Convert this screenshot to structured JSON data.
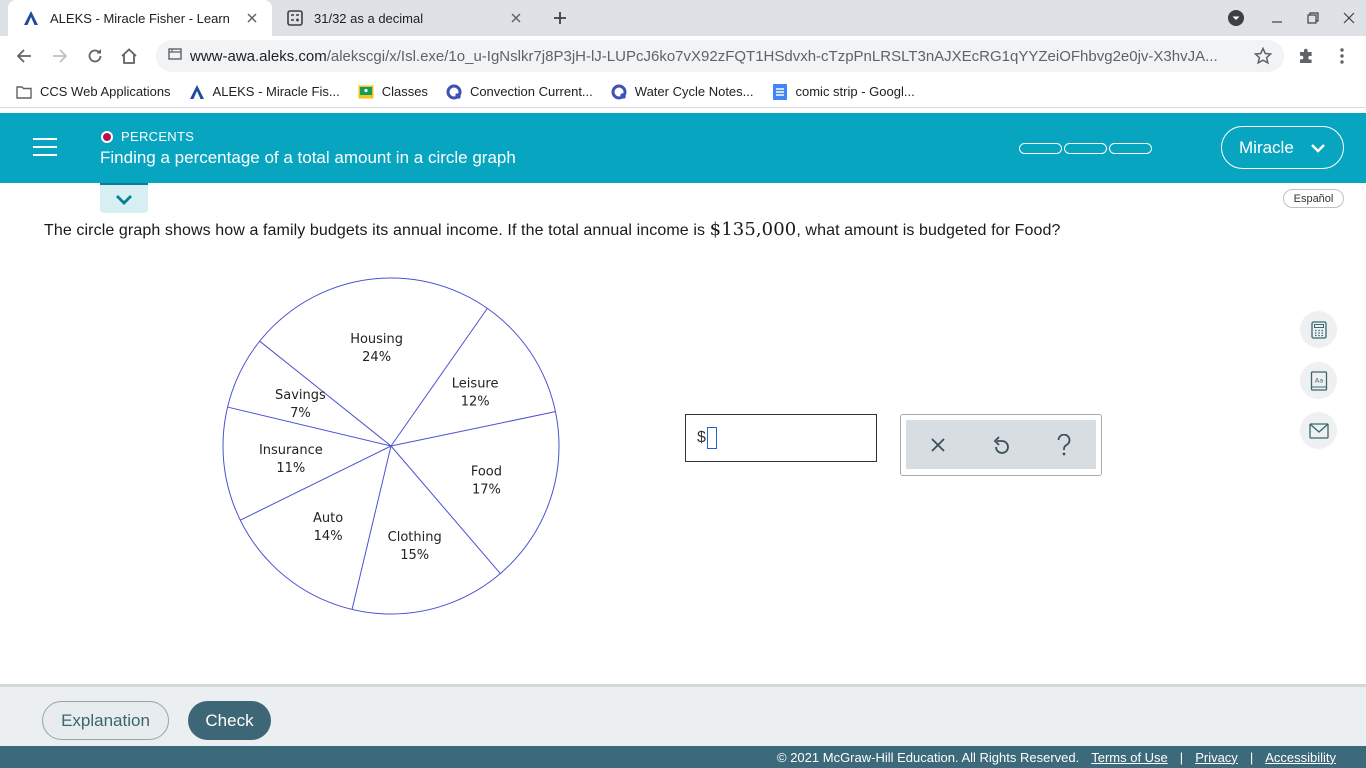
{
  "browser": {
    "tabs": [
      {
        "title": "ALEKS - Miracle Fisher - Learn",
        "active": true
      },
      {
        "title": "31/32 as a decimal",
        "active": false
      }
    ],
    "url_host": "www-awa.aleks.com",
    "url_path": "/alekscgi/x/Isl.exe/1o_u-IgNslkr7j8P3jH-lJ-LUPcJ6ko7vX92zFQT1HSdvxh-cTzpPnLRSLT3nAJXEcRG1qYYZeiOFhbvg2e0jv-X3hvJA...",
    "bookmarks": [
      {
        "label": "CCS Web Applications",
        "icon": "folder-icon"
      },
      {
        "label": "ALEKS - Miracle Fis...",
        "icon": "aleks-logo-icon"
      },
      {
        "label": "Classes",
        "icon": "classroom-icon"
      },
      {
        "label": "Convection Current...",
        "icon": "quizizz-icon"
      },
      {
        "label": "Water Cycle Notes...",
        "icon": "quizizz-icon"
      },
      {
        "label": "comic strip - Googl...",
        "icon": "docs-icon"
      }
    ]
  },
  "header": {
    "topic": "PERCENTS",
    "lesson": "Finding a percentage of a total amount in a circle graph",
    "user": "Miracle",
    "progress_segments": 3
  },
  "espanol": "Español",
  "question": {
    "before": "The circle graph shows how a family budgets its annual income. If the total annual income is ",
    "amount": "$135,000",
    "after": ", what amount is budgeted for Food?"
  },
  "chart_data": {
    "type": "pie",
    "slices": [
      {
        "label": "Housing",
        "percent_label": "24%",
        "value": 24
      },
      {
        "label": "Leisure",
        "percent_label": "12%",
        "value": 12
      },
      {
        "label": "Food",
        "percent_label": "17%",
        "value": 17
      },
      {
        "label": "Clothing",
        "percent_label": "15%",
        "value": 15
      },
      {
        "label": "Auto",
        "percent_label": "14%",
        "value": 14
      },
      {
        "label": "Insurance",
        "percent_label": "11%",
        "value": 11
      },
      {
        "label": "Savings",
        "percent_label": "7%",
        "value": 7
      }
    ],
    "colors": {
      "stroke": "#4a52d1"
    }
  },
  "answer": {
    "prefix": "$",
    "value": ""
  },
  "keypad": [
    "clear",
    "undo",
    "help"
  ],
  "footer": {
    "explanation": "Explanation",
    "check": "Check",
    "copyright": "© 2021 McGraw-Hill Education. All Rights Reserved.",
    "links": [
      "Terms of Use",
      "Privacy",
      "Accessibility"
    ]
  },
  "colors": {
    "header": "#08a5c1",
    "footer": "#3c6a7a",
    "check": "#3d6676"
  }
}
